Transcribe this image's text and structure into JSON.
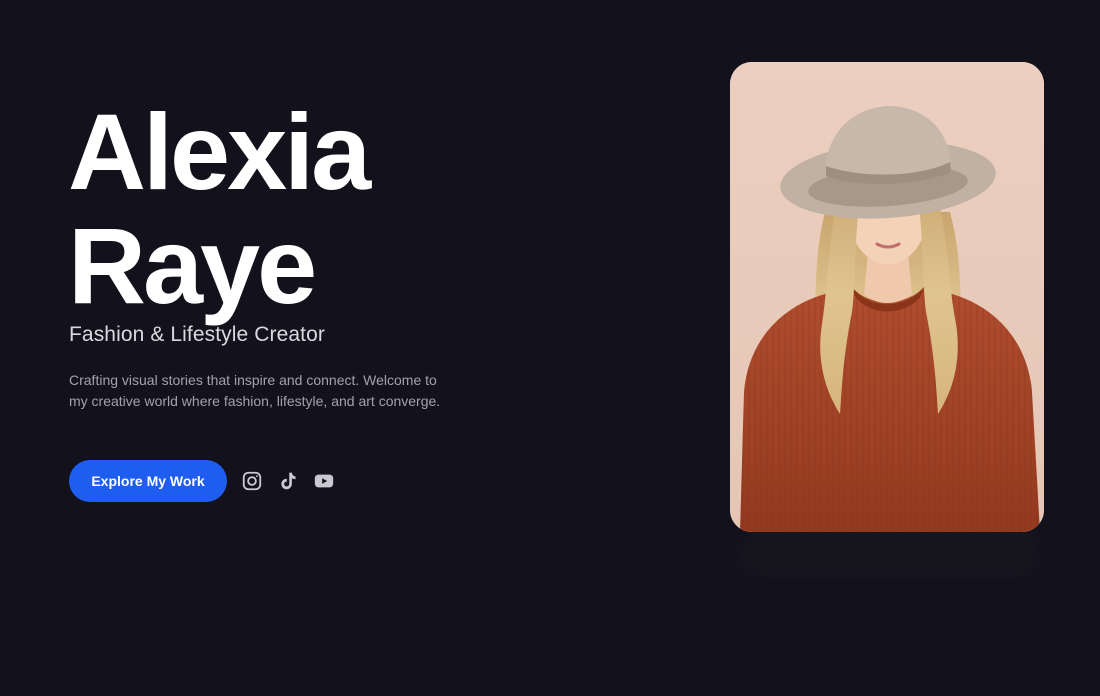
{
  "hero": {
    "first_name": "Alexia",
    "last_name": "Raye",
    "subtitle": "Fashion & Lifestyle Creator",
    "bio": "Crafting visual stories that inspire and connect. Welcome to my creative world where fashion, lifestyle, and art converge.",
    "cta_label": "Explore My Work"
  },
  "socials": [
    {
      "icon": "instagram-icon"
    },
    {
      "icon": "tiktok-icon"
    },
    {
      "icon": "youtube-icon"
    }
  ],
  "portrait": {
    "background": "#ead0c2",
    "sweater_color": "#a8462a",
    "hat_color": "#c4b4a6",
    "hair_color": "#d9bb85"
  },
  "colors": {
    "page_background": "#13121c",
    "accent": "#1f5cf0",
    "text_primary": "#ffffff",
    "text_secondary": "#a2a2ad"
  }
}
